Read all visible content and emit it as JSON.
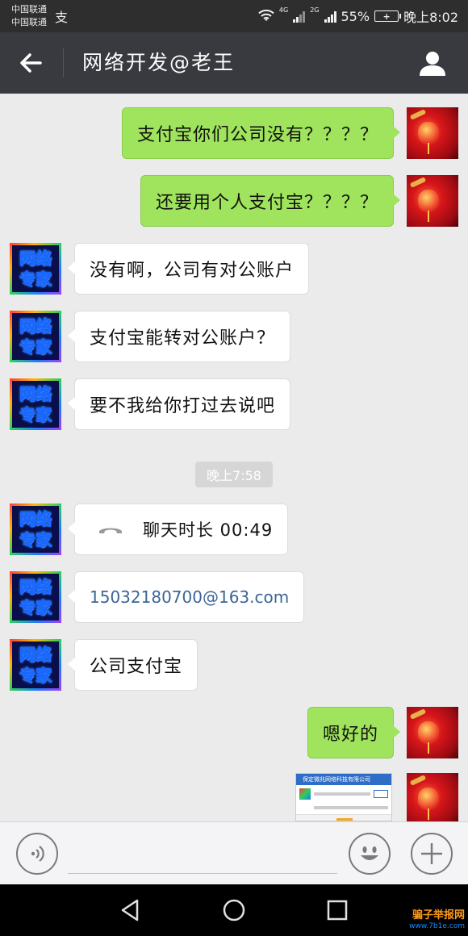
{
  "status_bar": {
    "carrier_1": "中国联通",
    "carrier_2": "中国联通",
    "net_1": "4G",
    "net_2": "2G",
    "battery_pct": "55%",
    "time": "晚上8:02"
  },
  "header": {
    "title": "网络开发@老王",
    "back_icon": "back-arrow-icon",
    "profile_icon": "person-icon"
  },
  "avatar_other": {
    "line1": "网络",
    "line2": "专家"
  },
  "messages": [
    {
      "side": "me",
      "text": "支付宝你们公司没有？？？？"
    },
    {
      "side": "me",
      "text": "还要用个人支付宝？？？？"
    },
    {
      "side": "other",
      "text": "没有啊，公司有对公账户"
    },
    {
      "side": "other",
      "text": "支付宝能转对公账户？"
    },
    {
      "side": "other",
      "text": "要不我给你打过去说吧"
    },
    {
      "side": "other",
      "type": "call",
      "text": "聊天时长 00:49"
    },
    {
      "side": "other",
      "type": "email",
      "text": "15032180700@163.com"
    },
    {
      "side": "other",
      "text": "公司支付宝"
    },
    {
      "side": "me",
      "text": "嗯好的"
    },
    {
      "side": "me",
      "type": "image"
    }
  ],
  "timestamp": "晚上7:58",
  "image_preview": {
    "bar_text": "保定微兆网络科技有限公司"
  },
  "watermark": {
    "main": "骗子举报网",
    "url": "www.7b1e.com"
  },
  "colors": {
    "my_bubble": "#9fe45c",
    "other_bubble": "#ffffff",
    "header_bg": "#393a3f",
    "chat_bg": "#ebebeb"
  }
}
